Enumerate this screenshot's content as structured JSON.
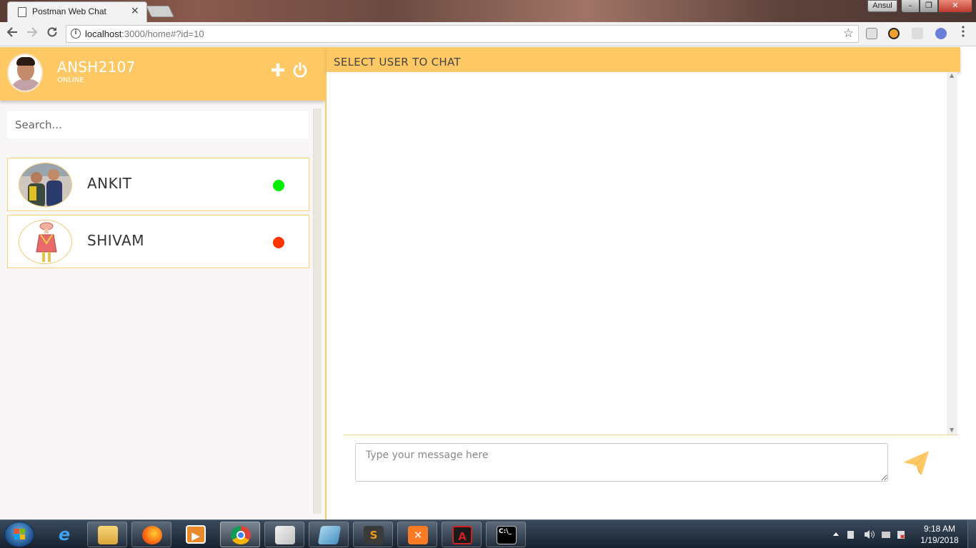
{
  "browser": {
    "tab_title": "Postman Web Chat",
    "tab_close": "×",
    "profile_name": "Ansul",
    "url_host": "localhost",
    "url_rest": ":3000/home#?id=10",
    "window_controls": {
      "minimize": "–",
      "maximize": "❐",
      "close": "✕"
    }
  },
  "sidebar": {
    "current_user": {
      "name": "ANSH2107",
      "status": "ONLINE"
    },
    "search_placeholder": "Search...",
    "users": [
      {
        "name": "ANKIT",
        "online": true,
        "status_color": "#00ee00"
      },
      {
        "name": "SHIVAM",
        "online": false,
        "status_color": "#ff3300"
      }
    ]
  },
  "chat": {
    "header_title": "SELECT USER TO CHAT",
    "message_placeholder": "Type your message here"
  },
  "colors": {
    "accent": "#fec965",
    "send_icon": "#fec965",
    "online": "#00ee00",
    "offline": "#ff3300"
  },
  "taskbar": {
    "time": "9:18 AM",
    "date": "1/19/2018"
  }
}
